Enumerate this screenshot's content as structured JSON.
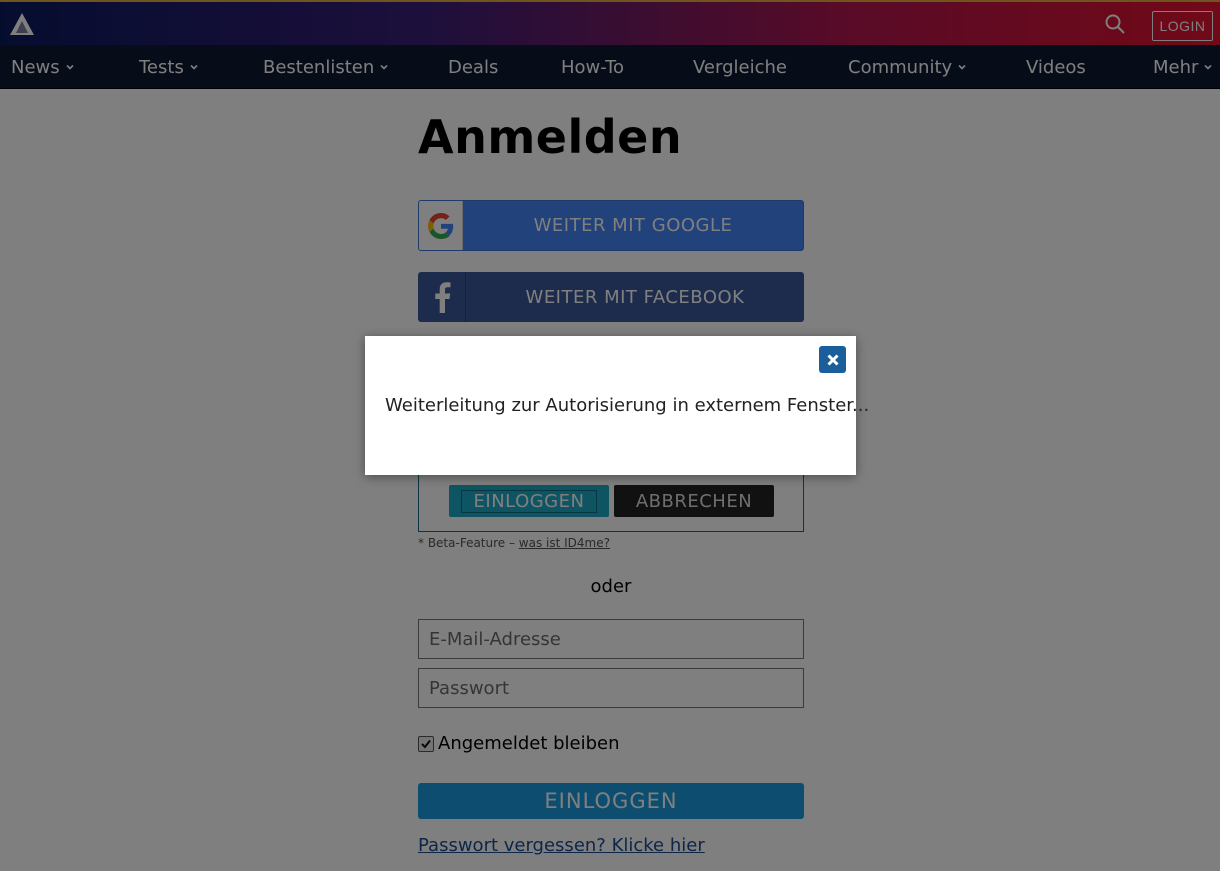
{
  "header": {
    "login_label": "LOGIN"
  },
  "nav": {
    "items": [
      {
        "label": "News",
        "dropdown": true
      },
      {
        "label": "Tests",
        "dropdown": true
      },
      {
        "label": "Bestenlisten",
        "dropdown": true
      },
      {
        "label": "Deals",
        "dropdown": false
      },
      {
        "label": "How-To",
        "dropdown": false
      },
      {
        "label": "Vergleiche",
        "dropdown": false
      },
      {
        "label": "Community",
        "dropdown": true
      },
      {
        "label": "Videos",
        "dropdown": false
      },
      {
        "label": "Mehr",
        "dropdown": true
      }
    ]
  },
  "login": {
    "title": "Anmelden",
    "google_label": "WEITER MIT GOOGLE",
    "facebook_label": "WEITER MIT FACEBOOK",
    "id4me_login_label": "EINLOGGEN",
    "id4me_cancel_label": "ABBRECHEN",
    "beta_prefix": "* Beta-Feature – ",
    "beta_link": "was ist ID4me?",
    "or_label": "oder",
    "email_placeholder": "E-Mail-Adresse",
    "password_placeholder": "Passwort",
    "remember_label": "Angemeldet bleiben",
    "remember_checked": true,
    "submit_label": "EINLOGGEN",
    "forgot_link": "Passwort vergessen? Klicke hier"
  },
  "modal": {
    "message": "Weiterleitung zur Autorisierung in externem Fenster..."
  },
  "colors": {
    "nav_bg": "#0c1b33",
    "google_blue": "#4285f4",
    "facebook_blue": "#3b5998",
    "primary_button": "#1a9ce0",
    "modal_close": "#1b5e9c"
  }
}
